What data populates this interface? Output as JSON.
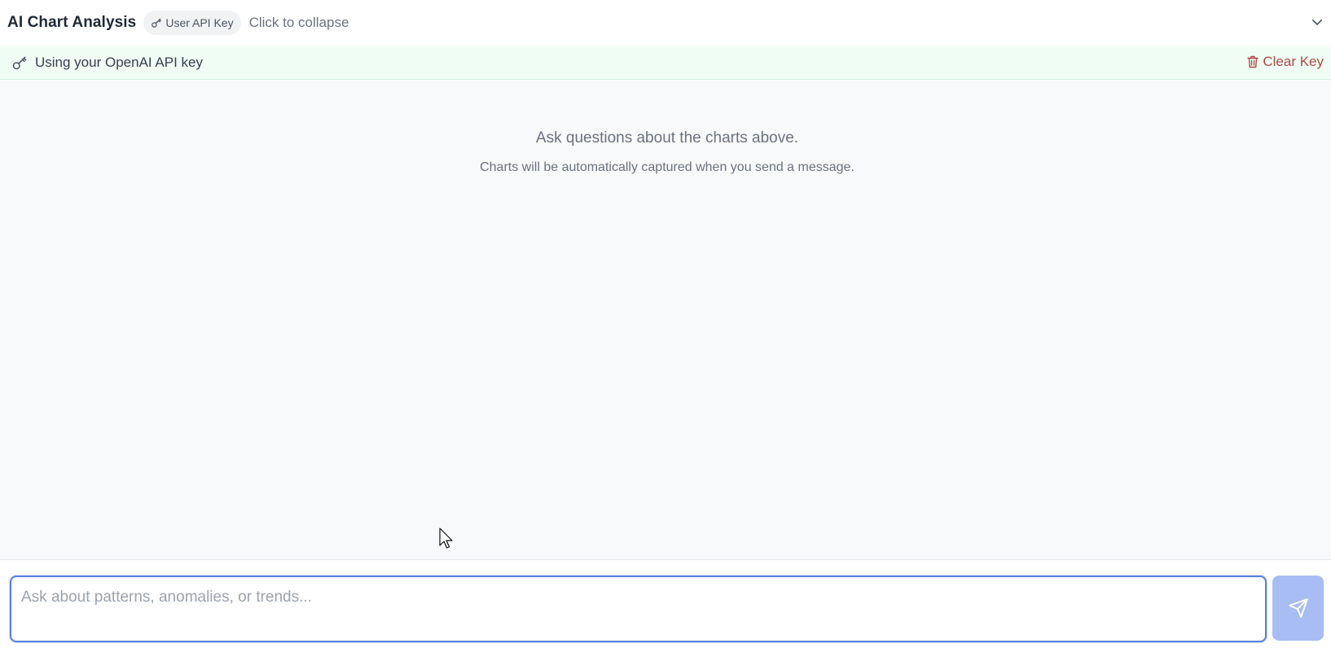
{
  "header": {
    "title": "AI Chart Analysis",
    "badge_label": "User API Key",
    "badge_icon": "key-icon",
    "collapse_hint": "Click to collapse",
    "toggle_icon": "chevron-down-icon"
  },
  "key_bar": {
    "status_icon": "key-icon",
    "status_text": "Using your OpenAI API key",
    "clear_icon": "trash-icon",
    "clear_label": "Clear Key"
  },
  "messages": {
    "empty_title": "Ask questions about the charts above.",
    "empty_subtitle": "Charts will be automatically captured when you send a message."
  },
  "composer": {
    "placeholder": "Ask about patterns, anomalies, or trends...",
    "value": "",
    "send_icon": "send-icon"
  },
  "colors": {
    "accent": "#5b7fe0",
    "send_button": "#a8bdf3",
    "key_bar_bg": "#f0fdf4",
    "clear_key": "#b04a44",
    "message_area_bg": "#f8f9fa"
  }
}
